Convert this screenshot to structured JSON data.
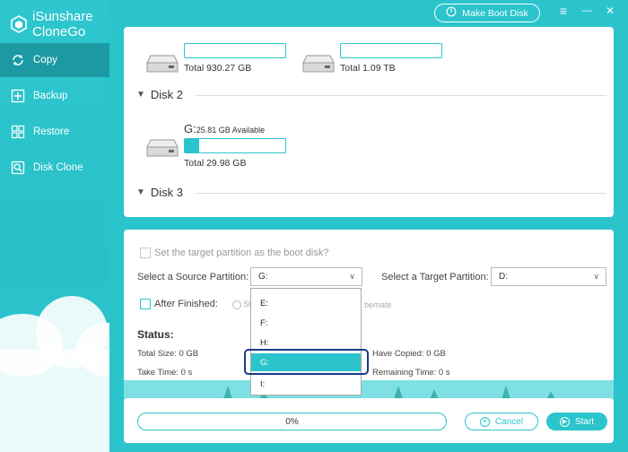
{
  "app": {
    "name_line1": "iSunshare",
    "name_line2": "CloneGo",
    "make_boot_disk": "Make Boot Disk",
    "menu_icon": "≡",
    "minimize_icon": "—",
    "close_icon": "✕"
  },
  "sidebar": {
    "items": [
      {
        "label": "Copy",
        "icon": "copy-icon",
        "active": true
      },
      {
        "label": "Backup",
        "icon": "backup-icon"
      },
      {
        "label": "Restore",
        "icon": "restore-icon"
      },
      {
        "label": "Disk Clone",
        "icon": "disk-clone-icon"
      }
    ]
  },
  "disks": {
    "disk1": {
      "partitions": [
        {
          "total": "Total 930.27 GB",
          "used_fraction": 0.0
        },
        {
          "total": "Total 1.09 TB",
          "used_fraction": 0.0
        }
      ]
    },
    "disk2": {
      "title": "Disk 2",
      "partition": {
        "letter": "G:",
        "available": "25.81 GB Available",
        "total": "Total 29.98 GB",
        "used_fraction": 0.14
      }
    },
    "disk3": {
      "title": "Disk 3"
    }
  },
  "options": {
    "boot_disk_label": "Set the target partition as the boot disk?",
    "source_label": "Select a Source Partition:",
    "source_value": "G:",
    "target_label": "Select a Target Partition:",
    "target_value": "D:",
    "after_finished_label": "After Finished:",
    "after_option1_partial": "Sh",
    "after_option2_partial": "bernate"
  },
  "status": {
    "title": "Status:",
    "total_size": "Total Size: 0 GB",
    "have_copied": "Have Copied: 0 GB",
    "take_time": "Take Time: 0 s",
    "remaining_time": "Remaining Time: 0 s"
  },
  "dropdown": {
    "items": [
      "E:",
      "F:",
      "H:",
      "G:",
      "I:"
    ],
    "selected": "G:"
  },
  "footer": {
    "progress": "0%",
    "progress_fraction": 0.0,
    "cancel": "Cancel",
    "start": "Start"
  },
  "colors": {
    "accent": "#2bc4cc",
    "active_nav": "#1b9aa3",
    "focus": "#1a3a8a"
  }
}
